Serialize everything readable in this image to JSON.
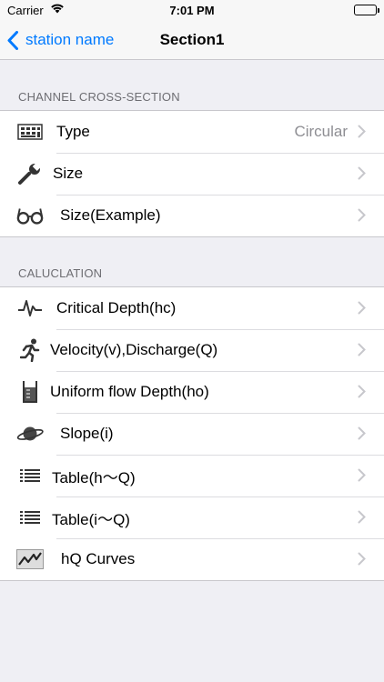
{
  "status": {
    "carrier": "Carrier",
    "time": "7:01 PM"
  },
  "nav": {
    "back_label": "station name",
    "title": "Section1"
  },
  "sections": [
    {
      "header": "CHANNEL CROSS-SECTION",
      "rows": [
        {
          "label": "Type",
          "value": "Circular",
          "icon": "keyboard-icon"
        },
        {
          "label": "Size",
          "value": "",
          "icon": "wrench-icon"
        },
        {
          "label": "Size(Example)",
          "value": "",
          "icon": "glasses-icon"
        }
      ]
    },
    {
      "header": "CALUCLATION",
      "rows": [
        {
          "label": "Critical Depth(hc)",
          "icon": "pulse-icon"
        },
        {
          "label": "Velocity(v),Discharge(Q)",
          "icon": "runner-icon"
        },
        {
          "label": "Uniform flow Depth(ho)",
          "icon": "beaker-icon"
        },
        {
          "label": "Slope(i)",
          "icon": "planet-icon"
        },
        {
          "label": "Table(h〜Q)",
          "icon": "list-icon"
        },
        {
          "label": "Table(i〜Q)",
          "icon": "list-icon"
        },
        {
          "label": "hQ Curves",
          "icon": "line-chart-icon"
        }
      ]
    }
  ],
  "colors": {
    "accent": "#007aff",
    "background": "#efeff4",
    "secondary_text": "#8e8e93"
  }
}
